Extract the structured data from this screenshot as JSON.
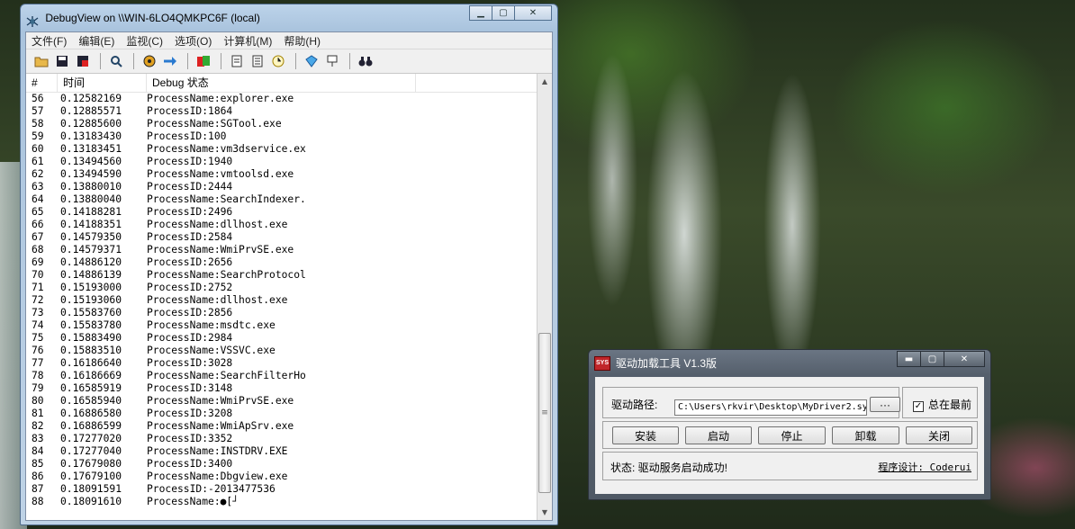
{
  "debugview": {
    "title": "DebugView on \\\\WIN-6LO4QMKPC6F (local)",
    "menus": [
      "文件(F)",
      "编辑(E)",
      "监视(C)",
      "选项(O)",
      "计算机(M)",
      "帮助(H)"
    ],
    "columns": {
      "num": "#",
      "time": "时间",
      "message": "Debug 状态"
    },
    "rows": [
      {
        "n": "56",
        "t": "0.12582169",
        "m": "ProcessName:explorer.exe"
      },
      {
        "n": "57",
        "t": "0.12885571",
        "m": "ProcessID:1864"
      },
      {
        "n": "58",
        "t": "0.12885600",
        "m": "ProcessName:SGTool.exe"
      },
      {
        "n": "59",
        "t": "0.13183430",
        "m": "ProcessID:100"
      },
      {
        "n": "60",
        "t": "0.13183451",
        "m": "ProcessName:vm3dservice.ex"
      },
      {
        "n": "61",
        "t": "0.13494560",
        "m": "ProcessID:1940"
      },
      {
        "n": "62",
        "t": "0.13494590",
        "m": "ProcessName:vmtoolsd.exe"
      },
      {
        "n": "63",
        "t": "0.13880010",
        "m": "ProcessID:2444"
      },
      {
        "n": "64",
        "t": "0.13880040",
        "m": "ProcessName:SearchIndexer."
      },
      {
        "n": "65",
        "t": "0.14188281",
        "m": "ProcessID:2496"
      },
      {
        "n": "66",
        "t": "0.14188351",
        "m": "ProcessName:dllhost.exe"
      },
      {
        "n": "67",
        "t": "0.14579350",
        "m": "ProcessID:2584"
      },
      {
        "n": "68",
        "t": "0.14579371",
        "m": "ProcessName:WmiPrvSE.exe"
      },
      {
        "n": "69",
        "t": "0.14886120",
        "m": "ProcessID:2656"
      },
      {
        "n": "70",
        "t": "0.14886139",
        "m": "ProcessName:SearchProtocol"
      },
      {
        "n": "71",
        "t": "0.15193000",
        "m": "ProcessID:2752"
      },
      {
        "n": "72",
        "t": "0.15193060",
        "m": "ProcessName:dllhost.exe"
      },
      {
        "n": "73",
        "t": "0.15583760",
        "m": "ProcessID:2856"
      },
      {
        "n": "74",
        "t": "0.15583780",
        "m": "ProcessName:msdtc.exe"
      },
      {
        "n": "75",
        "t": "0.15883490",
        "m": "ProcessID:2984"
      },
      {
        "n": "76",
        "t": "0.15883510",
        "m": "ProcessName:VSSVC.exe"
      },
      {
        "n": "77",
        "t": "0.16186640",
        "m": "ProcessID:3028"
      },
      {
        "n": "78",
        "t": "0.16186669",
        "m": "ProcessName:SearchFilterHo"
      },
      {
        "n": "79",
        "t": "0.16585919",
        "m": "ProcessID:3148"
      },
      {
        "n": "80",
        "t": "0.16585940",
        "m": "ProcessName:WmiPrvSE.exe"
      },
      {
        "n": "81",
        "t": "0.16886580",
        "m": "ProcessID:3208"
      },
      {
        "n": "82",
        "t": "0.16886599",
        "m": "ProcessName:WmiApSrv.exe"
      },
      {
        "n": "83",
        "t": "0.17277020",
        "m": "ProcessID:3352"
      },
      {
        "n": "84",
        "t": "0.17277040",
        "m": "ProcessName:INSTDRV.EXE"
      },
      {
        "n": "85",
        "t": "0.17679080",
        "m": "ProcessID:3400"
      },
      {
        "n": "86",
        "t": "0.17679100",
        "m": "ProcessName:Dbgview.exe"
      },
      {
        "n": "87",
        "t": "0.18091591",
        "m": "ProcessID:-2013477536"
      },
      {
        "n": "88",
        "t": "0.18091610",
        "m": "ProcessName:●[┘"
      }
    ]
  },
  "driver_tool": {
    "title": "驱动加载工具 V1.3版",
    "icon_text": "SYS",
    "path_label": "驱动路径:",
    "path_value": "C:\\Users\\rkvir\\Desktop\\MyDriver2.sy",
    "browse_label": "···",
    "always_on_top_label": "总在最前",
    "always_on_top_checked": "✓",
    "buttons": {
      "install": "安装",
      "start": "启动",
      "stop": "停止",
      "uninstall": "卸载",
      "close": "关闭"
    },
    "status": "状态: 驱动服务启动成功!",
    "credit": "程序设计: Coderui"
  }
}
